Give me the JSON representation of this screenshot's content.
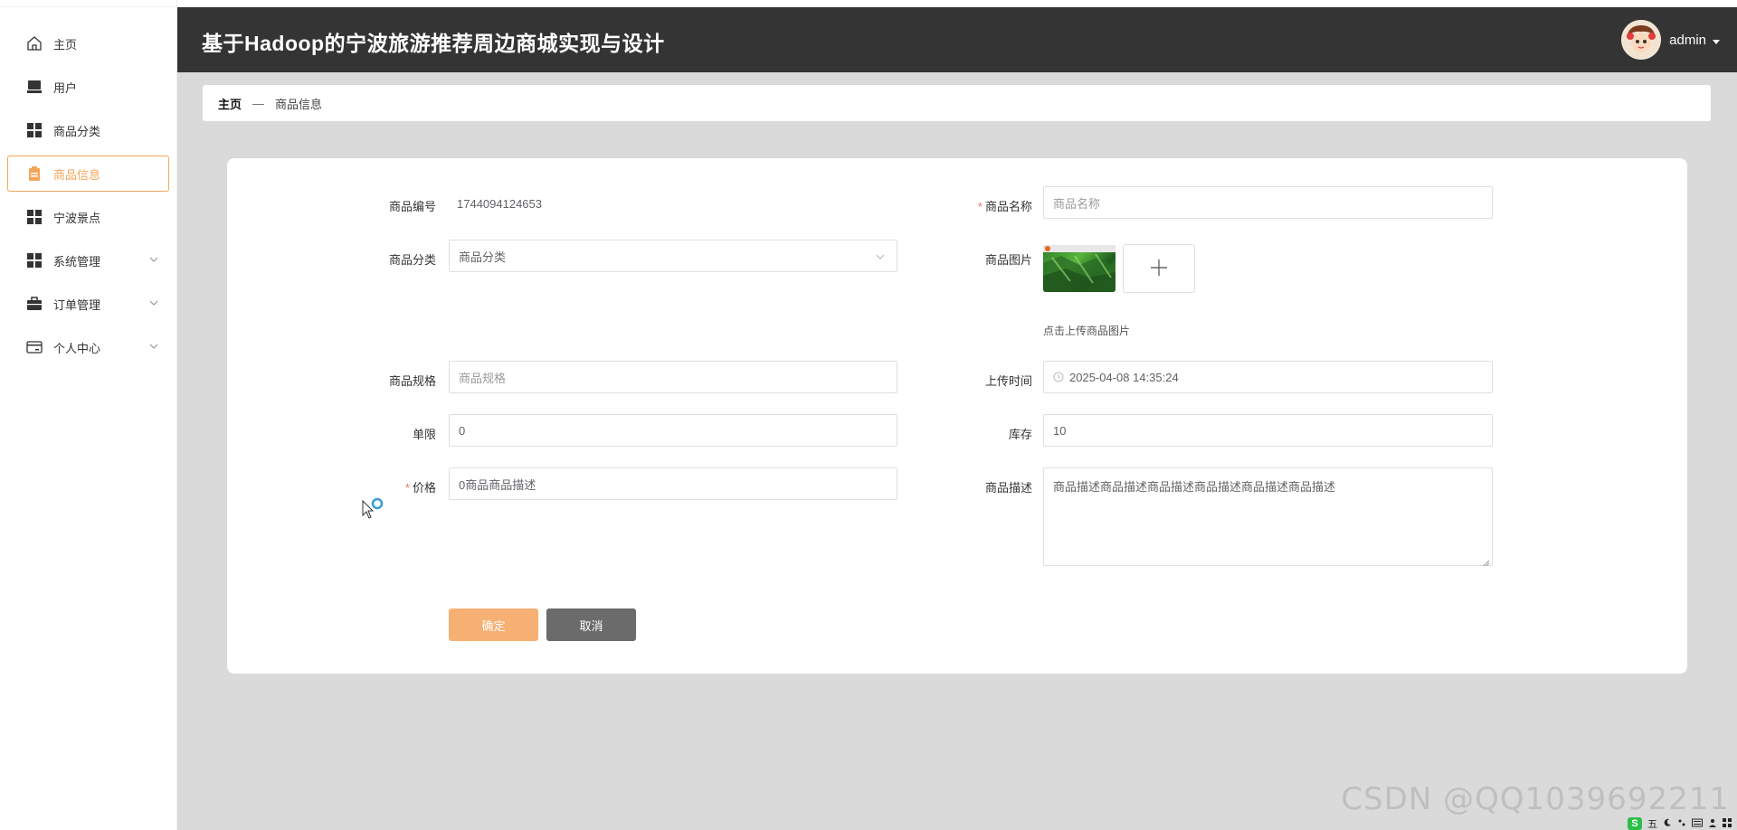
{
  "app": {
    "title": "基于Hadoop的宁波旅游推荐周边商城实现与设计",
    "username": "admin"
  },
  "sidebar": {
    "items": [
      {
        "label": "主页",
        "icon": "home-icon",
        "active": false,
        "has_children": false
      },
      {
        "label": "用户",
        "icon": "monitor-icon",
        "active": false,
        "has_children": false
      },
      {
        "label": "商品分类",
        "icon": "grid-icon",
        "active": false,
        "has_children": false
      },
      {
        "label": "商品信息",
        "icon": "clipboard-icon",
        "active": true,
        "has_children": false
      },
      {
        "label": "宁波景点",
        "icon": "grid-icon",
        "active": false,
        "has_children": false
      },
      {
        "label": "系统管理",
        "icon": "grid-icon",
        "active": false,
        "has_children": true
      },
      {
        "label": "订单管理",
        "icon": "briefcase-icon",
        "active": false,
        "has_children": true
      },
      {
        "label": "个人中心",
        "icon": "card-icon",
        "active": false,
        "has_children": true
      }
    ]
  },
  "breadcrumb": {
    "home": "主页",
    "separator": "—",
    "current": "商品信息"
  },
  "form": {
    "product_code": {
      "label": "商品编号",
      "value": "1744094124653"
    },
    "product_name": {
      "label": "商品名称",
      "placeholder": "商品名称",
      "required": true
    },
    "category": {
      "label": "商品分类",
      "placeholder": "商品分类"
    },
    "image": {
      "label": "商品图片",
      "hint": "点击上传商品图片"
    },
    "spec": {
      "label": "商品规格",
      "placeholder": "商品规格"
    },
    "upload_time": {
      "label": "上传时间",
      "value": "2025-04-08 14:35:24"
    },
    "limit": {
      "label": "单限",
      "value": "0"
    },
    "stock": {
      "label": "库存",
      "value": "10"
    },
    "price": {
      "label": "价格",
      "value": "0商品商品描述",
      "required": true
    },
    "description": {
      "label": "商品描述",
      "value": "商品描述商品描述商品描述商品描述商品描述商品描述"
    },
    "buttons": {
      "confirm": "确定",
      "cancel": "取消"
    }
  },
  "watermark": "CSDN @QQ1039692211",
  "taskbar": {
    "ime": "S",
    "mode": "五"
  },
  "colors": {
    "header_bg": "#333433",
    "accent": "#f5a55a",
    "confirm_button": "#f6b073",
    "cancel_button": "#6b6b6b",
    "main_bg": "#dadada",
    "required": "#f56c6c"
  }
}
